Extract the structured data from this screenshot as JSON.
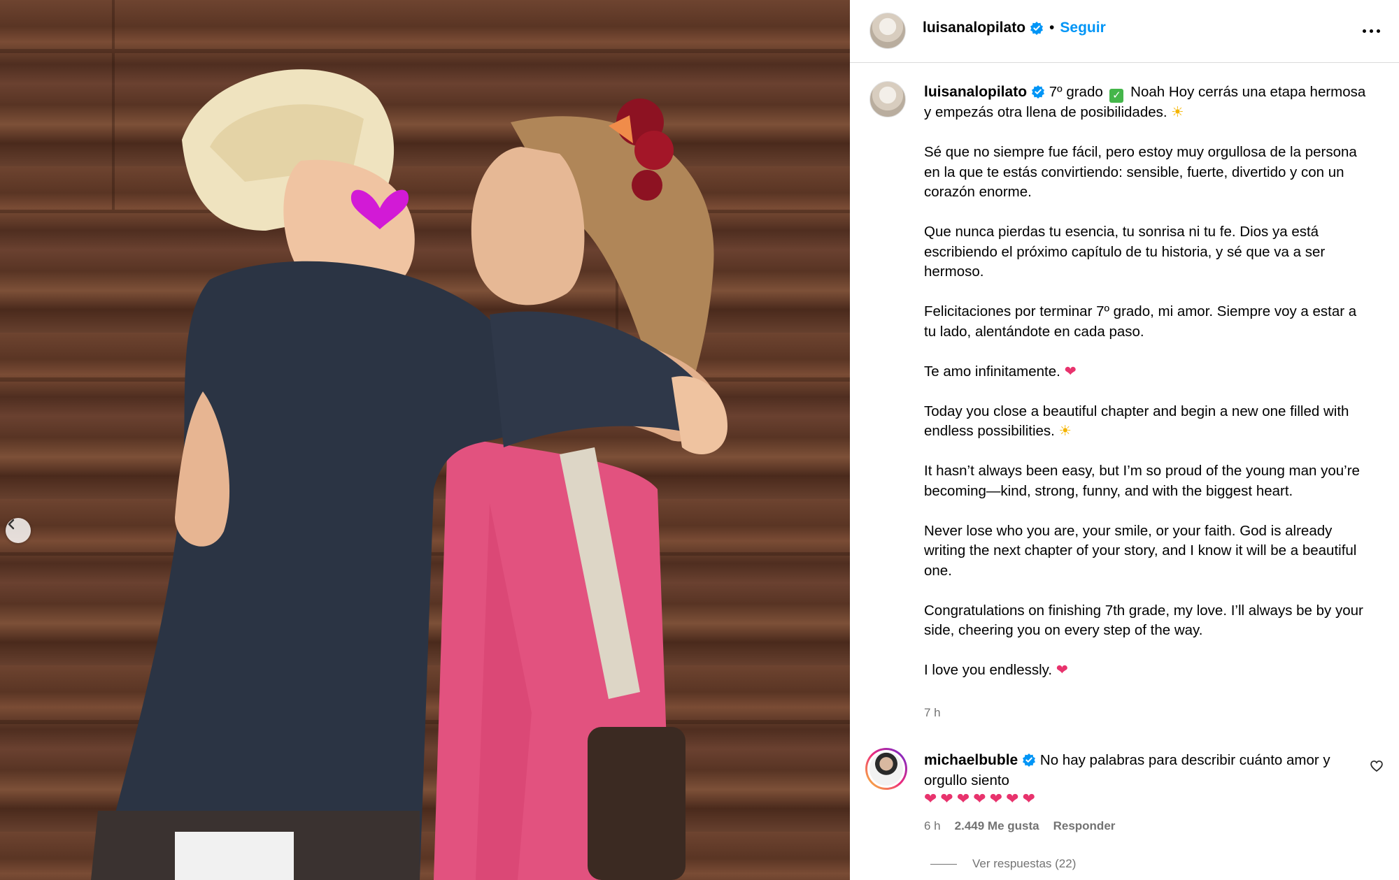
{
  "post": {
    "username": "luisanalopilato",
    "follow_label": "Seguir",
    "separator": "•",
    "more_icon": "more-horizontal-icon"
  },
  "caption": {
    "username": "luisanalopilato",
    "intro_a": "7º grado",
    "intro_b": "Noah Hoy cerrás una etapa hermosa y empezás otra llena de posibilidades.",
    "p2": "Sé que no siempre fue fácil, pero estoy muy orgullosa de la persona en la que te estás convirtiendo: sensible, fuerte, divertido y con un corazón enorme.",
    "p3": "Que nunca pierdas tu esencia, tu sonrisa ni tu fe. Dios ya está escribiendo el próximo capítulo de tu historia, y sé que va a ser hermoso.",
    "p4": "Felicitaciones por terminar 7º grado, mi amor. Siempre voy a estar a tu lado, alentándote en cada paso.",
    "p5": "Te amo infinitamente.",
    "p6": "Today you close a beautiful chapter and begin a new one filled with endless possibilities.",
    "p7": "It hasn’t always been easy, but I’m so proud of the young man you’re becoming—kind, strong, funny, and with the biggest heart.",
    "p8": "Never lose who you are, your smile, or your faith. God is already writing the next chapter of your story, and I know it will be a beautiful one.",
    "p9": "Congratulations on finishing 7th grade, my love. I’ll always be by your side, cheering you on every step of the way.",
    "p10": "I love you endlessly.",
    "time": "7 h"
  },
  "emoji": {
    "sun": "☀",
    "heart": "❤",
    "check": "✓"
  },
  "comment": {
    "username": "michaelbuble",
    "text": "No hay palabras para describir cuánto amor y orgullo siento",
    "hearts": "❤❤❤❤❤❤❤",
    "time": "6 h",
    "likes": "2.449 Me gusta",
    "reply_label": "Responder",
    "view_replies": "Ver respuestas (22)"
  },
  "colors": {
    "accent": "#0095f6",
    "heart": "#e8336d",
    "muted": "#737373"
  }
}
